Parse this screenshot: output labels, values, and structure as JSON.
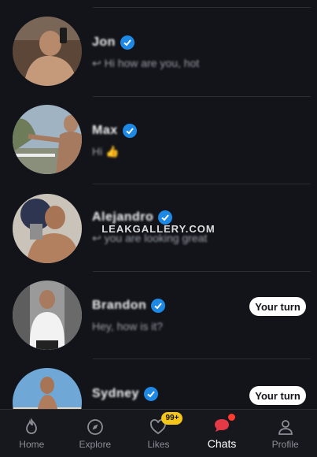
{
  "watermark": "LEAKGALLERY.COM",
  "chats": [
    {
      "name": "Jon",
      "preview": "↩ Hi how are you, hot",
      "action": "",
      "avatar": "person-photo"
    },
    {
      "name": "Max",
      "preview": "Hi 👍",
      "action": "",
      "avatar": "person-photo"
    },
    {
      "name": "Alejandro",
      "preview": "↩ you are looking great",
      "action": "",
      "avatar": "person-photo"
    },
    {
      "name": "Brandon",
      "preview": "Hey, how is it?",
      "action": "Your turn",
      "avatar": "person-photo"
    },
    {
      "name": "Sydney",
      "preview": "",
      "action": "Your turn",
      "avatar": "person-photo"
    }
  ],
  "tabs": [
    {
      "label": "Home",
      "icon": "home-icon",
      "active": false
    },
    {
      "label": "Explore",
      "icon": "compass-icon",
      "active": false
    },
    {
      "label": "Likes",
      "icon": "heart-icon",
      "active": false,
      "badge": "99+"
    },
    {
      "label": "Chats",
      "icon": "chat-bubble-icon",
      "active": true
    },
    {
      "label": "Profile",
      "icon": "user-icon",
      "active": false
    }
  ],
  "colors": {
    "background": "#121419",
    "accent_verified": "#1e88e5",
    "badge": "#f5c518",
    "notification": "#ff3b30",
    "pill_bg": "#ffffff"
  }
}
